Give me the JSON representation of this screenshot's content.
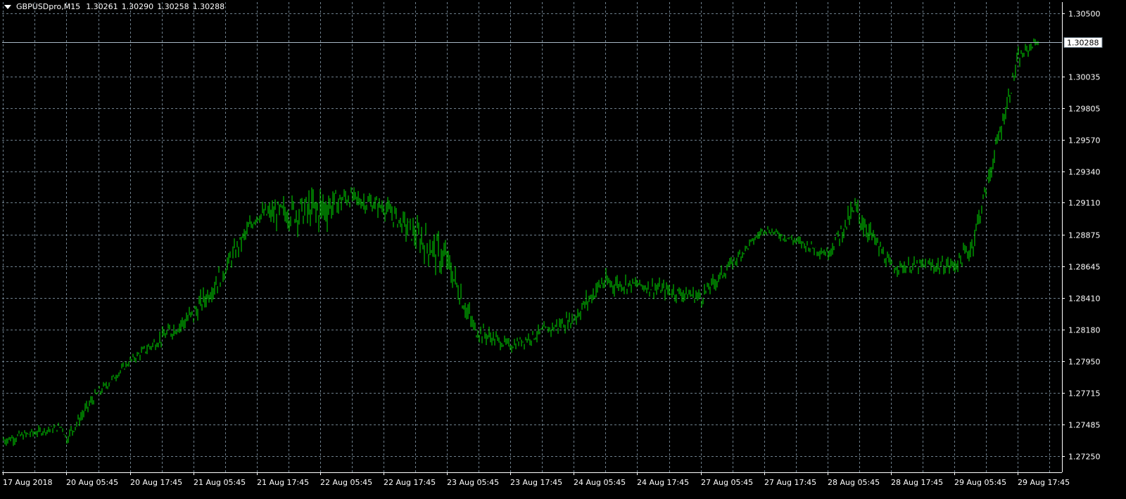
{
  "header": {
    "symbol_timeframe": "GBPUSDpro,M15",
    "open": "1.30261",
    "high": "1.30290",
    "low": "1.30258",
    "close": "1.30288"
  },
  "colors": {
    "background": "#000000",
    "foreground": "#ffffff",
    "grid": "#6e7f8c",
    "price_bars": "#00e000",
    "bid_line": "#a9b9c6"
  },
  "current_price": {
    "label": "1.30288",
    "value": 1.30288
  },
  "chart_data": {
    "type": "line",
    "chart_style": "ohlc-bars",
    "symbol": "GBPUSDpro",
    "timeframe": "M15",
    "title": "GBPUSDpro,M15",
    "xlabel": "",
    "ylabel": "",
    "grid": true,
    "grid_style": "dashed",
    "legend": "none",
    "ylim": [
      1.27134,
      1.30581
    ],
    "y_ticks": [
      "1.30500",
      "1.30035",
      "1.29805",
      "1.29570",
      "1.29340",
      "1.29110",
      "1.28875",
      "1.28645",
      "1.28410",
      "1.28180",
      "1.27950",
      "1.27715",
      "1.27485",
      "1.27250"
    ],
    "x_ticks": [
      "17 Aug 2018",
      "20 Aug 05:45",
      "20 Aug 17:45",
      "21 Aug 05:45",
      "21 Aug 17:45",
      "22 Aug 05:45",
      "22 Aug 17:45",
      "23 Aug 05:45",
      "23 Aug 17:45",
      "24 Aug 05:45",
      "24 Aug 17:45",
      "27 Aug 05:45",
      "27 Aug 17:45",
      "28 Aug 05:45",
      "28 Aug 17:45",
      "29 Aug 05:45",
      "29 Aug 17:45"
    ],
    "series": [
      {
        "name": "GBPUSDpro",
        "x": [
          "17 Aug 2018",
          "17 Aug 17:45",
          "20 Aug 05:45",
          "20 Aug 11:45",
          "20 Aug 17:45",
          "21 Aug 05:45",
          "21 Aug 11:45",
          "21 Aug 17:45",
          "22 Aug 05:45",
          "22 Aug 11:45",
          "22 Aug 17:45",
          "23 Aug 05:45",
          "23 Aug 11:45",
          "23 Aug 17:45",
          "24 Aug 05:45",
          "24 Aug 11:45",
          "24 Aug 17:45",
          "27 Aug 05:45",
          "27 Aug 17:45",
          "28 Aug 05:45",
          "28 Aug 11:45",
          "28 Aug 17:45",
          "29 Aug 05:45",
          "29 Aug 09:45",
          "29 Aug 17:45",
          "29 Aug 21:45"
        ],
        "y": [
          1.2737,
          1.2747,
          1.2738,
          1.2768,
          1.2795,
          1.2829,
          1.2858,
          1.2902,
          1.2906,
          1.2915,
          1.2908,
          1.2868,
          1.2818,
          1.2806,
          1.2826,
          1.2852,
          1.2851,
          1.2842,
          1.2892,
          1.2874,
          1.2906,
          1.2864,
          1.2865,
          1.2878,
          1.3015,
          1.30288
        ],
        "low": [
          1.273,
          1.2741,
          1.2726,
          1.2756,
          1.279,
          1.2812,
          1.2836,
          1.2899,
          1.287,
          1.29,
          1.2894,
          1.285,
          1.2805,
          1.2797,
          1.2812,
          1.2836,
          1.2838,
          1.2826,
          1.2885,
          1.286,
          1.289,
          1.2852,
          1.2848,
          1.2862,
          1.2997,
          1.3022
        ],
        "high": [
          1.2748,
          1.2752,
          1.2746,
          1.2774,
          1.2802,
          1.2846,
          1.2869,
          1.2925,
          1.2934,
          1.2932,
          1.2922,
          1.2908,
          1.2833,
          1.2814,
          1.2838,
          1.2868,
          1.286,
          1.2852,
          1.2898,
          1.2879,
          1.2931,
          1.2872,
          1.2872,
          1.2896,
          1.3025,
          1.3034
        ]
      }
    ],
    "current_bid": 1.30288
  }
}
